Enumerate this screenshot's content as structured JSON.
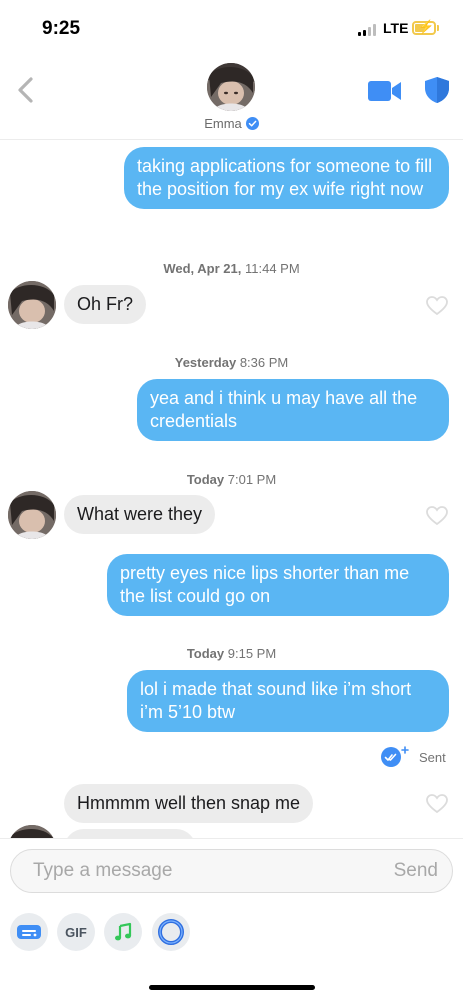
{
  "status_bar": {
    "time": "9:25",
    "network": "LTE",
    "battery_icon": "battery-charging-icon"
  },
  "header": {
    "back_icon": "chevron-left-icon",
    "contact_name": "Emma",
    "verified_icon": "verified-badge-icon",
    "video_icon": "video-call-icon",
    "safety_icon": "shield-icon"
  },
  "messages": [
    {
      "type": "outgoing",
      "text": "taking applications for someone to fill the position for my ex wife right now"
    },
    {
      "type": "timestamp",
      "day": "Wed, Apr 21,",
      "time": "11:44 PM"
    },
    {
      "type": "incoming",
      "text": "Oh Fr?"
    },
    {
      "type": "timestamp",
      "day": "Yesterday",
      "time": "8:36 PM"
    },
    {
      "type": "outgoing",
      "text": "yea and i think u may have all the credentials"
    },
    {
      "type": "timestamp",
      "day": "Today",
      "time": "7:01 PM"
    },
    {
      "type": "incoming",
      "text": "What were they"
    },
    {
      "type": "outgoing",
      "text": "pretty eyes nice lips shorter than me the list could go on"
    },
    {
      "type": "timestamp",
      "day": "Today",
      "time": "9:15 PM"
    },
    {
      "type": "outgoing",
      "text": "lol i made that sound like i’m short i’m 5’10 btw"
    },
    {
      "type": "status",
      "text": "Sent"
    },
    {
      "type": "incoming",
      "text": "Hmmmm well then snap me"
    }
  ],
  "composer": {
    "placeholder": "Type a message",
    "send_label": "Send",
    "tools": [
      {
        "icon": "sticker-card-icon"
      },
      {
        "label": "GIF"
      },
      {
        "icon": "music-note-icon"
      },
      {
        "icon": "ring-icon"
      }
    ]
  },
  "colors": {
    "outgoing_bubble": "#5ab6f3",
    "incoming_bubble": "#ececec",
    "accent_blue": "#3f8ef5",
    "music_green": "#34c759"
  }
}
